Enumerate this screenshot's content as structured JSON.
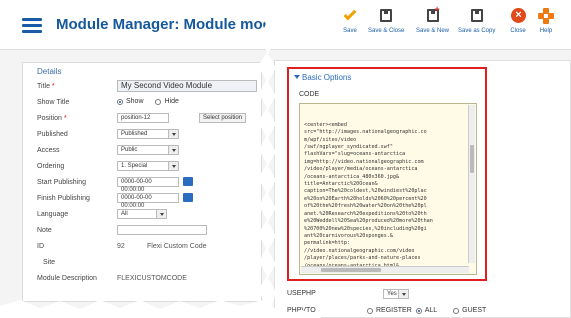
{
  "left": {
    "title": "Module Manager: Module mod_f",
    "details_heading": "Details",
    "fields": {
      "title": {
        "label": "Title",
        "value": "My Second Video Module"
      },
      "show_title": {
        "label": "Show Title",
        "opt_show": "Show",
        "opt_hide": "Hide"
      },
      "position": {
        "label": "Position",
        "value": "position-12",
        "button": "Select position"
      },
      "published": {
        "label": "Published",
        "value": "Published"
      },
      "access": {
        "label": "Access",
        "value": "Public"
      },
      "ordering": {
        "label": "Ordering",
        "value": "1. Special"
      },
      "start_publishing": {
        "label": "Start Publishing",
        "value": "0000-00-00 00:00:00"
      },
      "finish_publishing": {
        "label": "Finish Publishing",
        "value": "0000-00-00 00:00:00"
      },
      "language": {
        "label": "Language",
        "value": "All"
      },
      "note": {
        "label": "Note",
        "value": ""
      },
      "id": {
        "label": "ID",
        "value": "92",
        "extra": "Flexi Custom Code"
      },
      "site": {
        "label": "Site"
      },
      "module_description": {
        "label": "Module Description",
        "value": "FLEXICUSTOMCODE"
      }
    }
  },
  "toolbar": {
    "save": "Save",
    "save_close": "Save & Close",
    "save_new": "Save & New",
    "save_copy": "Save as Copy",
    "close": "Close",
    "help": "Help"
  },
  "right": {
    "basic_options": "Basic Options",
    "code_label": "CODE",
    "code_text": "<center><embed\nsrc=\"http://images.nationalgeographic.co\nm/wpf/sites/video\n/swf/ngplayer_syndicated.swf\"\nflashVars=\"slug=oceans-antarctica\nimg=http://video.nationalgeographic.com\n/video/player/media/oceans-antarctica\n/oceans-antarctica_480x360.jpg&\ntitle=Antarctic%20Ocean&\ncaption=The%20coldest,%20windiest%20plac\ne%20on%20Earth%20holds%2060%20percent%20\nof%20the%20fresh%20water%20on%20the%20pl\nanet.%20Research%20expeditions%20to%20th\ne%20Weddell%20Sea%20produced%20more%20than\n%20700%20new%20species,%20including%20gi\nant%20carnivorous%20sponges.&\npermalink=http:\n//video.nationalgeographic.com/video\n/player/places/parks-and-nature-places\n/oceans/oceans-antarctica.html&",
    "usephp_label": "USEPHP",
    "usephp_value": "Yes",
    "phpvto_label": "PHPVTO",
    "opt_register": "REGISTER",
    "opt_all": "ALL",
    "opt_guest": "GUEST"
  }
}
